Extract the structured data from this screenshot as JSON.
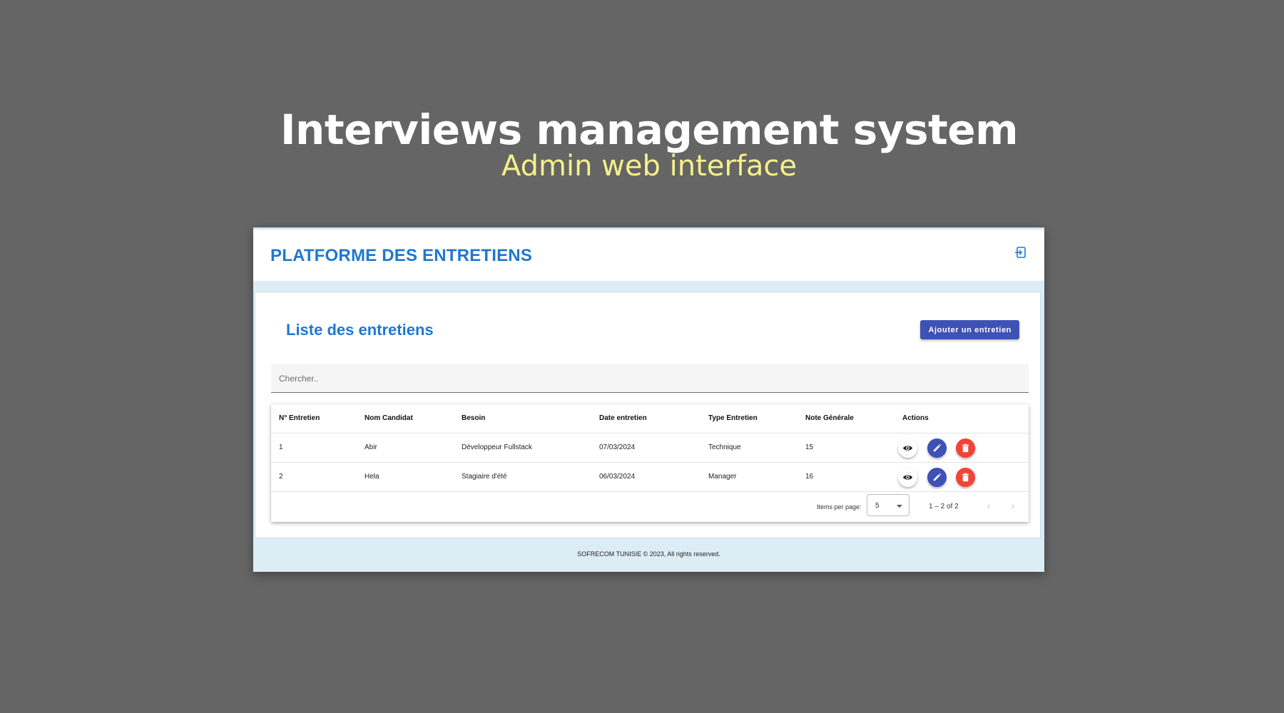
{
  "hero": {
    "title": "Interviews management system",
    "subtitle": "Admin web interface"
  },
  "app": {
    "brand": "PLATFORME DES ENTRETIENS",
    "logout_icon": "logout-icon",
    "page_title": "Liste des entretiens",
    "add_button_label": "Ajouter un entretien",
    "search_placeholder": "Chercher..",
    "footer": "SOFRECOM TUNISIE © 2023, All rights reserved."
  },
  "table": {
    "columns": [
      "N° Entretien",
      "Nom Candidat",
      "Besoin",
      "Date entretien",
      "Type Entretien",
      "Note Générale",
      "Actions"
    ],
    "rows": [
      {
        "num": "1",
        "candidate": "Abir",
        "need": "Développeur Fullstack",
        "date": "07/03/2024",
        "type": "Technique",
        "score": "15"
      },
      {
        "num": "2",
        "candidate": "Hela",
        "need": "Stagiaire d'été",
        "date": "06/03/2024",
        "type": "Manager",
        "score": "16"
      }
    ],
    "actions": [
      "eye-icon",
      "pencil-icon",
      "trash-icon"
    ]
  },
  "paginator": {
    "items_per_page_label": "Items per page:",
    "page_size": "5",
    "range": "1 – 2 of 2",
    "prev_icon": "chevron-left-icon",
    "next_icon": "chevron-right-icon"
  },
  "colors": {
    "background": "#656565",
    "subtitle": "#f6f08a",
    "brand": "#1f78d1",
    "primary_button": "#3e51b5",
    "delete": "#f44336",
    "frame": "#ddedf5"
  }
}
